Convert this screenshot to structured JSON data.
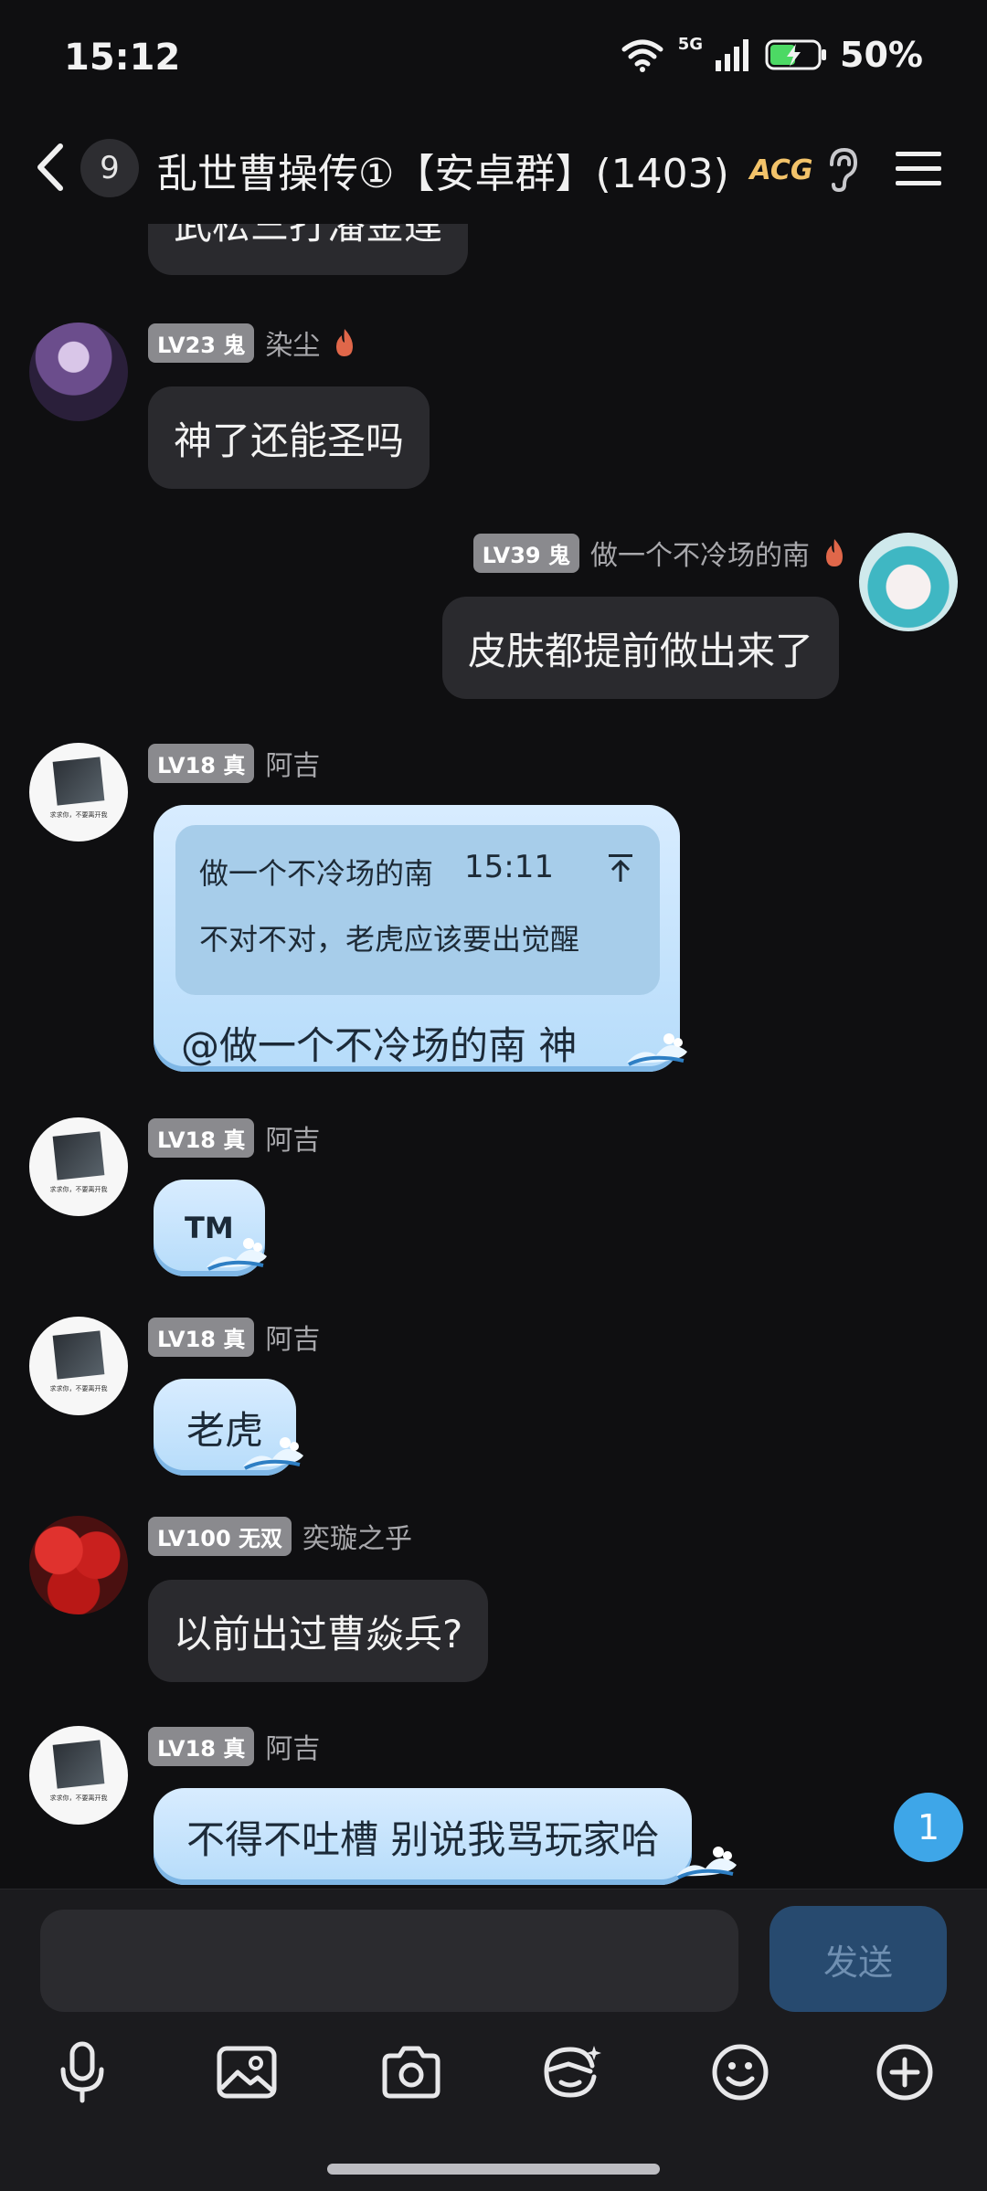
{
  "status_bar": {
    "time": "15:12",
    "network": "5G",
    "battery_pct": "50%"
  },
  "header": {
    "unread_count": "9",
    "title": "乱世曹操传①【安卓群】(1403)",
    "acg_badge": "ACG"
  },
  "messages": [
    {
      "id": "m0",
      "partial_text": "武松三打潘金莲"
    },
    {
      "id": "m1",
      "level": "LV23 鬼",
      "nick": "染尘",
      "text": "神了还能圣吗"
    },
    {
      "id": "m2",
      "level": "LV39 鬼",
      "nick": "做一个不冷场的南",
      "text": "皮肤都提前做出来了",
      "self": true
    },
    {
      "id": "m3",
      "level": "LV18 真",
      "nick": "阿吉",
      "quote": {
        "name": "做一个不冷场的南",
        "time": "15:11",
        "text": "不对不对，老虎应该要出觉醒"
      },
      "text": "@做一个不冷场的南 神"
    },
    {
      "id": "m4",
      "level": "LV18 真",
      "nick": "阿吉",
      "text": "TM"
    },
    {
      "id": "m5",
      "level": "LV18 真",
      "nick": "阿吉",
      "text": "老虎"
    },
    {
      "id": "m6",
      "level": "LV100 无双",
      "nick": "奕璇之乎",
      "text": "以前出过曹焱兵?"
    },
    {
      "id": "m7",
      "level": "LV18 真",
      "nick": "阿吉",
      "text": "不得不吐槽 别说我骂玩家哈"
    }
  ],
  "new_message_count": "1",
  "composer": {
    "input_value": "",
    "send_label": "发送"
  },
  "toolbar": [
    "mic-icon",
    "image-icon",
    "camera-icon",
    "sticker-icon",
    "emoji-icon",
    "plus-icon"
  ],
  "colors": {
    "background": "#0f0f11",
    "bubble_dark": "#2a2a2e",
    "bubble_blue": "#b6dcfa",
    "level_badge": "#8a8a8e",
    "send_disabled": "#274a6f",
    "new_msg_badge": "#3ea6e8"
  }
}
